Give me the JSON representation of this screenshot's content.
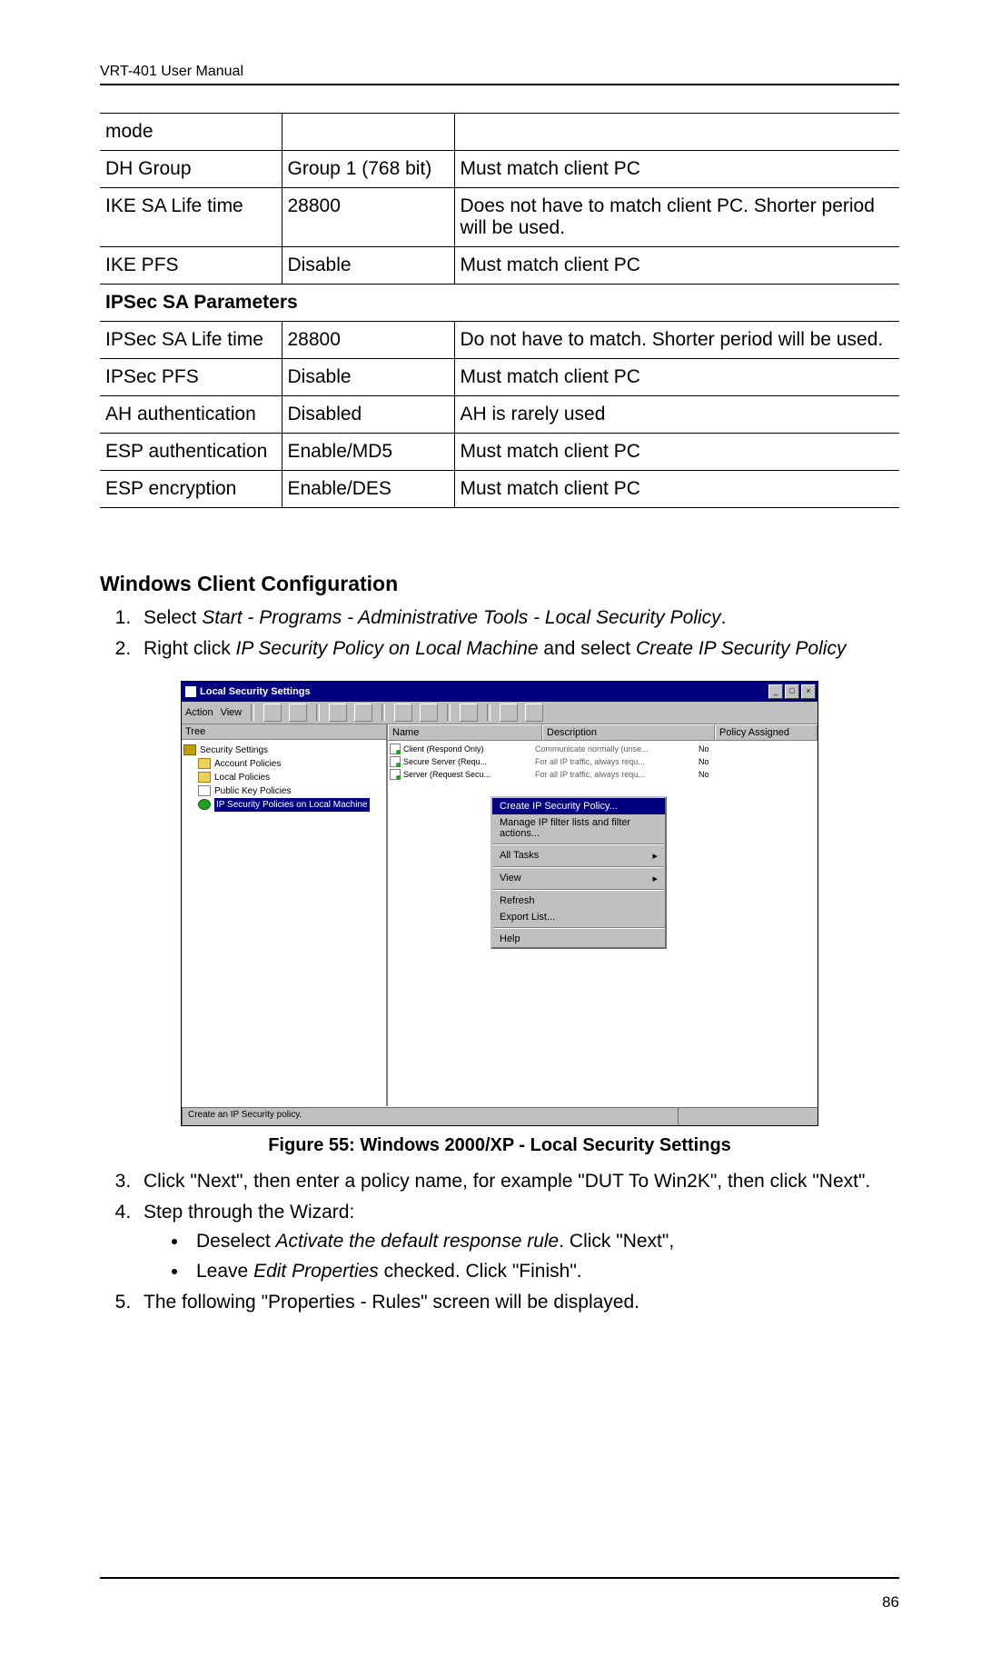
{
  "header": "VRT-401 User Manual",
  "page_number": "86",
  "table": {
    "rows": [
      {
        "c1": "mode",
        "c2": "",
        "c3": ""
      },
      {
        "c1": "DH Group",
        "c2": "Group 1 (768 bit)",
        "c3": "Must match client PC"
      },
      {
        "c1": "IKE SA Life time",
        "c2": "28800",
        "c3": "Does not have to match client PC. Shorter period will be used."
      },
      {
        "c1": "IKE PFS",
        "c2": "Disable",
        "c3": "Must match client PC"
      }
    ],
    "section_header": "IPSec SA Parameters",
    "rows2": [
      {
        "c1": "IPSec SA Life time",
        "c2": "28800",
        "c3": "Do not have to match. Shorter period will be used."
      },
      {
        "c1": "IPSec PFS",
        "c2": "Disable",
        "c3": "Must match client PC"
      },
      {
        "c1": "AH authentication",
        "c2": "Disabled",
        "c3": "AH is rarely used"
      },
      {
        "c1": "ESP authentication",
        "c2": "Enable/MD5",
        "c3": "Must match client PC"
      },
      {
        "c1": "ESP encryption",
        "c2": "Enable/DES",
        "c3": "Must match client PC"
      }
    ]
  },
  "section_title": "Windows Client Configuration",
  "step1_a": "Select ",
  "step1_b": "Start - Programs - Administrative Tools - Local Security Policy",
  "step1_c": ".",
  "step2_a": "Right click ",
  "step2_b": "IP Security Policy on Local Machine",
  "step2_c": " and select ",
  "step2_d": "Create IP Security Policy",
  "mmc": {
    "title": "Local Security Settings",
    "menu_action": "Action",
    "menu_view": "View",
    "tree_tab": "Tree",
    "tree": {
      "root": "Security Settings",
      "item1": "Account Policies",
      "item2": "Local Policies",
      "item3": "Public Key Policies",
      "item4": "IP Security Policies on Local Machine"
    },
    "list_headers": {
      "name": "Name",
      "desc": "Description",
      "assigned": "Policy Assigned"
    },
    "list_rows": [
      {
        "name": "Client (Respond Only)",
        "desc": "Communicate normally (unse...",
        "assigned": "No"
      },
      {
        "name": "Secure Server (Requ...",
        "desc": "For all IP traffic, always requ...",
        "assigned": "No"
      },
      {
        "name": "Server (Request Secu...",
        "desc": "For all IP traffic, always requ...",
        "assigned": "No"
      }
    ],
    "context": {
      "create": "Create IP Security Policy...",
      "manage": "Manage IP filter lists and filter actions...",
      "all_tasks": "All Tasks",
      "view": "View",
      "refresh": "Refresh",
      "export": "Export List...",
      "help": "Help"
    },
    "status": "Create an IP Security policy."
  },
  "figure_caption": "Figure 55: Windows 2000/XP - Local Security Settings",
  "step3": "Click \"Next\", then enter a policy name, for example \"DUT To Win2K\", then click \"Next\".",
  "step4": "Step through the Wizard:",
  "bullet1_a": "Deselect ",
  "bullet1_b": "Activate the default response rule",
  "bullet1_c": ".  Click \"Next\",",
  "bullet2_a": "Leave ",
  "bullet2_b": "Edit Properties",
  "bullet2_c": " checked.  Click \"Finish\".",
  "step5": "The following \"Properties - Rules\" screen will be displayed."
}
